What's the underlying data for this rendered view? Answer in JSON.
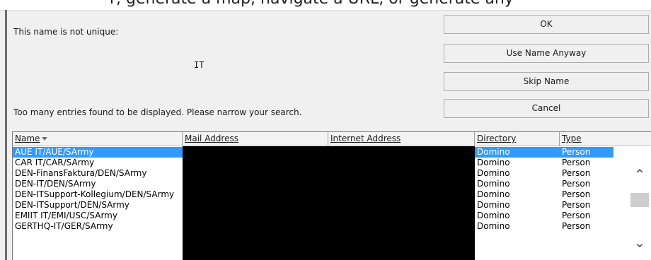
{
  "background_text": "r, generate a map, navigate a URL, or generate any",
  "dialog": {
    "message_not_unique": "This name is not unique:",
    "query": "IT",
    "message_too_many": "Too many entries found to be displayed. Please narrow your search."
  },
  "buttons": {
    "ok": "OK",
    "use_anyway": "Use Name Anyway",
    "skip": "Skip Name",
    "cancel": "Cancel"
  },
  "table": {
    "columns": [
      "Name",
      "Mail Address",
      "Internet Address",
      "Directory",
      "Type"
    ],
    "rows": [
      {
        "name": "AUE IT/AUE/SArmy",
        "directory": "Domino",
        "type": "Person"
      },
      {
        "name": "CAR IT/CAR/SArmy",
        "directory": "Domino",
        "type": "Person"
      },
      {
        "name": "DEN-FinansFaktura/DEN/SArmy",
        "directory": "Domino",
        "type": "Person"
      },
      {
        "name": "DEN-IT/DEN/SArmy",
        "directory": "Domino",
        "type": "Person"
      },
      {
        "name": "DEN-ITSupport-Kollegium/DEN/SArmy",
        "directory": "Domino",
        "type": "Person"
      },
      {
        "name": "DEN-ITSupport/DEN/SArmy",
        "directory": "Domino",
        "type": "Person"
      },
      {
        "name": "EMIIT IT/EMI/USC/SArmy",
        "directory": "Domino",
        "type": "Person"
      },
      {
        "name": "GERTHQ-IT/GER/SArmy",
        "directory": "Domino",
        "type": "Person"
      }
    ]
  },
  "icons": {
    "sort": "sort-desc-icon",
    "scroll_up": "chevron-up-icon",
    "scroll_down": "chevron-down-icon"
  },
  "colors": {
    "selection": "#3399ff",
    "redaction": "#000000"
  }
}
